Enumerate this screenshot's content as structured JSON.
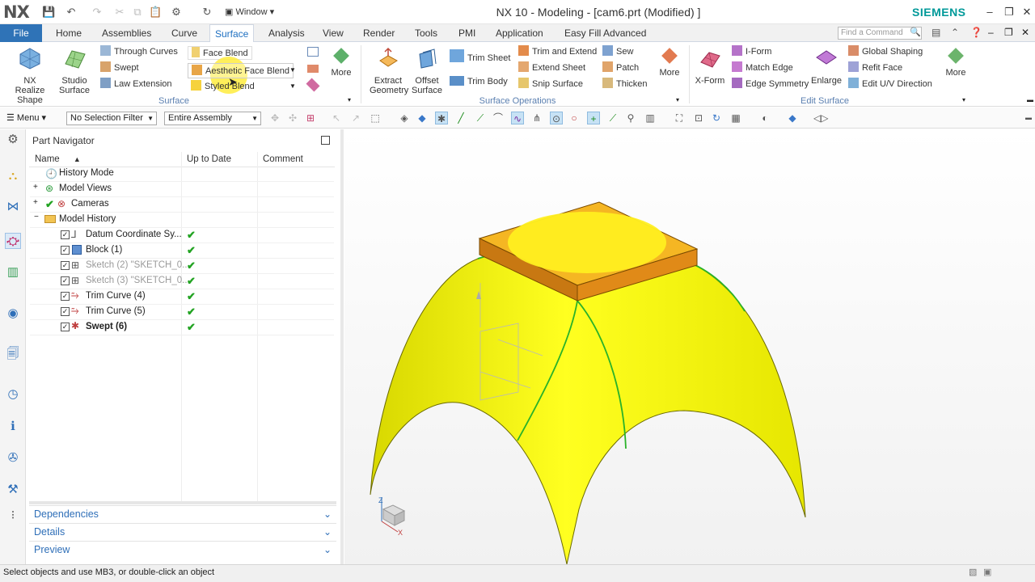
{
  "app": {
    "logo": "NX",
    "title": "NX 10 - Modeling - [cam6.prt (Modified) ]",
    "brand": "SIEMENS",
    "window_menu": "Window"
  },
  "menubar": {
    "file": "File",
    "tabs": [
      "Home",
      "Assemblies",
      "Curve",
      "Surface",
      "Analysis",
      "View",
      "Render",
      "Tools",
      "PMI",
      "Application",
      "Easy Fill Advanced"
    ],
    "active_tab": "Surface",
    "find_placeholder": "Find a Command"
  },
  "ribbon": {
    "surface_group": {
      "label": "Surface",
      "nx_realize": "NX Realize Shape",
      "studio": "Studio Surface",
      "through_curves": "Through Curves",
      "swept": "Swept",
      "law_extension": "Law Extension",
      "face_blend": "Face Blend",
      "aesthetic_face_blend": "Aesthetic Face Blend",
      "styled_blend": "Styled Blend",
      "more": "More"
    },
    "surface_ops_group": {
      "label": "Surface Operations",
      "extract_geometry": "Extract Geometry",
      "offset_surface": "Offset Surface",
      "trim_sheet": "Trim Sheet",
      "trim_body": "Trim Body",
      "trim_and_extend": "Trim and Extend",
      "extend_sheet": "Extend Sheet",
      "snip_surface": "Snip Surface",
      "sew": "Sew",
      "patch": "Patch",
      "thicken": "Thicken",
      "more": "More"
    },
    "edit_surface_group": {
      "label": "Edit Surface",
      "x_form": "X-Form",
      "i_form": "I-Form",
      "match_edge": "Match Edge",
      "edge_symmetry": "Edge Symmetry",
      "enlarge": "Enlarge",
      "global_shaping": "Global Shaping",
      "refit_face": "Refit Face",
      "edit_uv_direction": "Edit U/V Direction",
      "more": "More"
    }
  },
  "toolbar": {
    "menu": "Menu",
    "selection_filter": "No Selection Filter",
    "assembly_scope": "Entire Assembly"
  },
  "navigator": {
    "title": "Part Navigator",
    "columns": [
      "Name",
      "Up to Date",
      "Comment"
    ],
    "rows": [
      {
        "name": "History Mode",
        "checkbox": false,
        "uptodate": ""
      },
      {
        "name": "Model Views",
        "checkbox": false,
        "uptodate": ""
      },
      {
        "name": "Cameras",
        "checkbox": false,
        "uptodate": ""
      },
      {
        "name": "Model History",
        "checkbox": false,
        "uptodate": ""
      },
      {
        "name": "Datum Coordinate Sy...",
        "checkbox": true,
        "uptodate": "✔"
      },
      {
        "name": "Block (1)",
        "checkbox": true,
        "uptodate": "✔"
      },
      {
        "name": "Sketch (2) \"SKETCH_0...",
        "checkbox": true,
        "uptodate": "✔"
      },
      {
        "name": "Sketch (3) \"SKETCH_0...",
        "checkbox": true,
        "uptodate": "✔"
      },
      {
        "name": "Trim Curve (4)",
        "checkbox": true,
        "uptodate": "✔"
      },
      {
        "name": "Trim Curve (5)",
        "checkbox": true,
        "uptodate": "✔"
      },
      {
        "name": "Swept (6)",
        "checkbox": true,
        "uptodate": "✔"
      }
    ],
    "sections": [
      "Dependencies",
      "Details",
      "Preview"
    ]
  },
  "status": {
    "message": "Select objects and use MB3, or double-click an object"
  },
  "colors": {
    "accent": "#2f73b7",
    "brand": "#009999",
    "surface": "#f4f400",
    "block": "#f3a21e"
  }
}
